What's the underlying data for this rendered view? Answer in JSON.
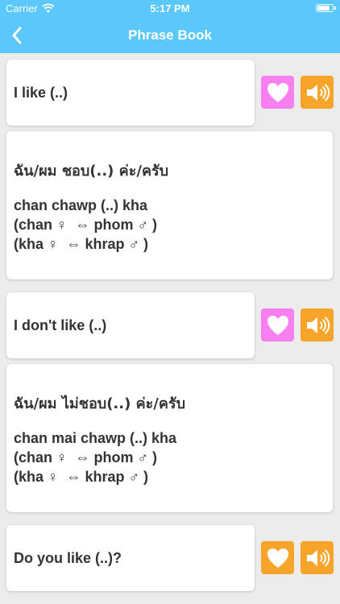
{
  "status_bar": {
    "carrier": "Carrier",
    "time": "5:17 PM"
  },
  "nav": {
    "title": "Phrase Book",
    "back_icon": "chevron-left-icon"
  },
  "colors": {
    "nav_background": "#5ac8fa",
    "favorite_inactive": "#f77ff0",
    "favorite_active": "#f6a52a",
    "speaker": "#f6a52a",
    "page_background": "#ececec"
  },
  "phrases": [
    {
      "english": "I like (..)",
      "thai": "ฉัน/ผม ชอบ(..) ค่ะ/ครับ",
      "roman": [
        "chan chawp (..) kha",
        "(chan ♀  ⇔ phom ♂ )",
        "(kha ♀  ⇔ khrap ♂ )"
      ],
      "favorite_icon": "heart-icon",
      "speaker_icon": "speaker-icon"
    },
    {
      "english": "I don't like (..)",
      "thai": "ฉัน/ผม ไม่ชอบ(..) ค่ะ/ครับ",
      "roman": [
        "chan mai chawp (..) kha",
        "(chan ♀  ⇔ phom ♂ )",
        "(kha ♀  ⇔ khrap ♂ )"
      ],
      "favorite_icon": "heart-icon",
      "speaker_icon": "speaker-icon"
    },
    {
      "english": "Do you like (..)?",
      "favorite_icon": "heart-icon",
      "speaker_icon": "speaker-icon"
    }
  ]
}
